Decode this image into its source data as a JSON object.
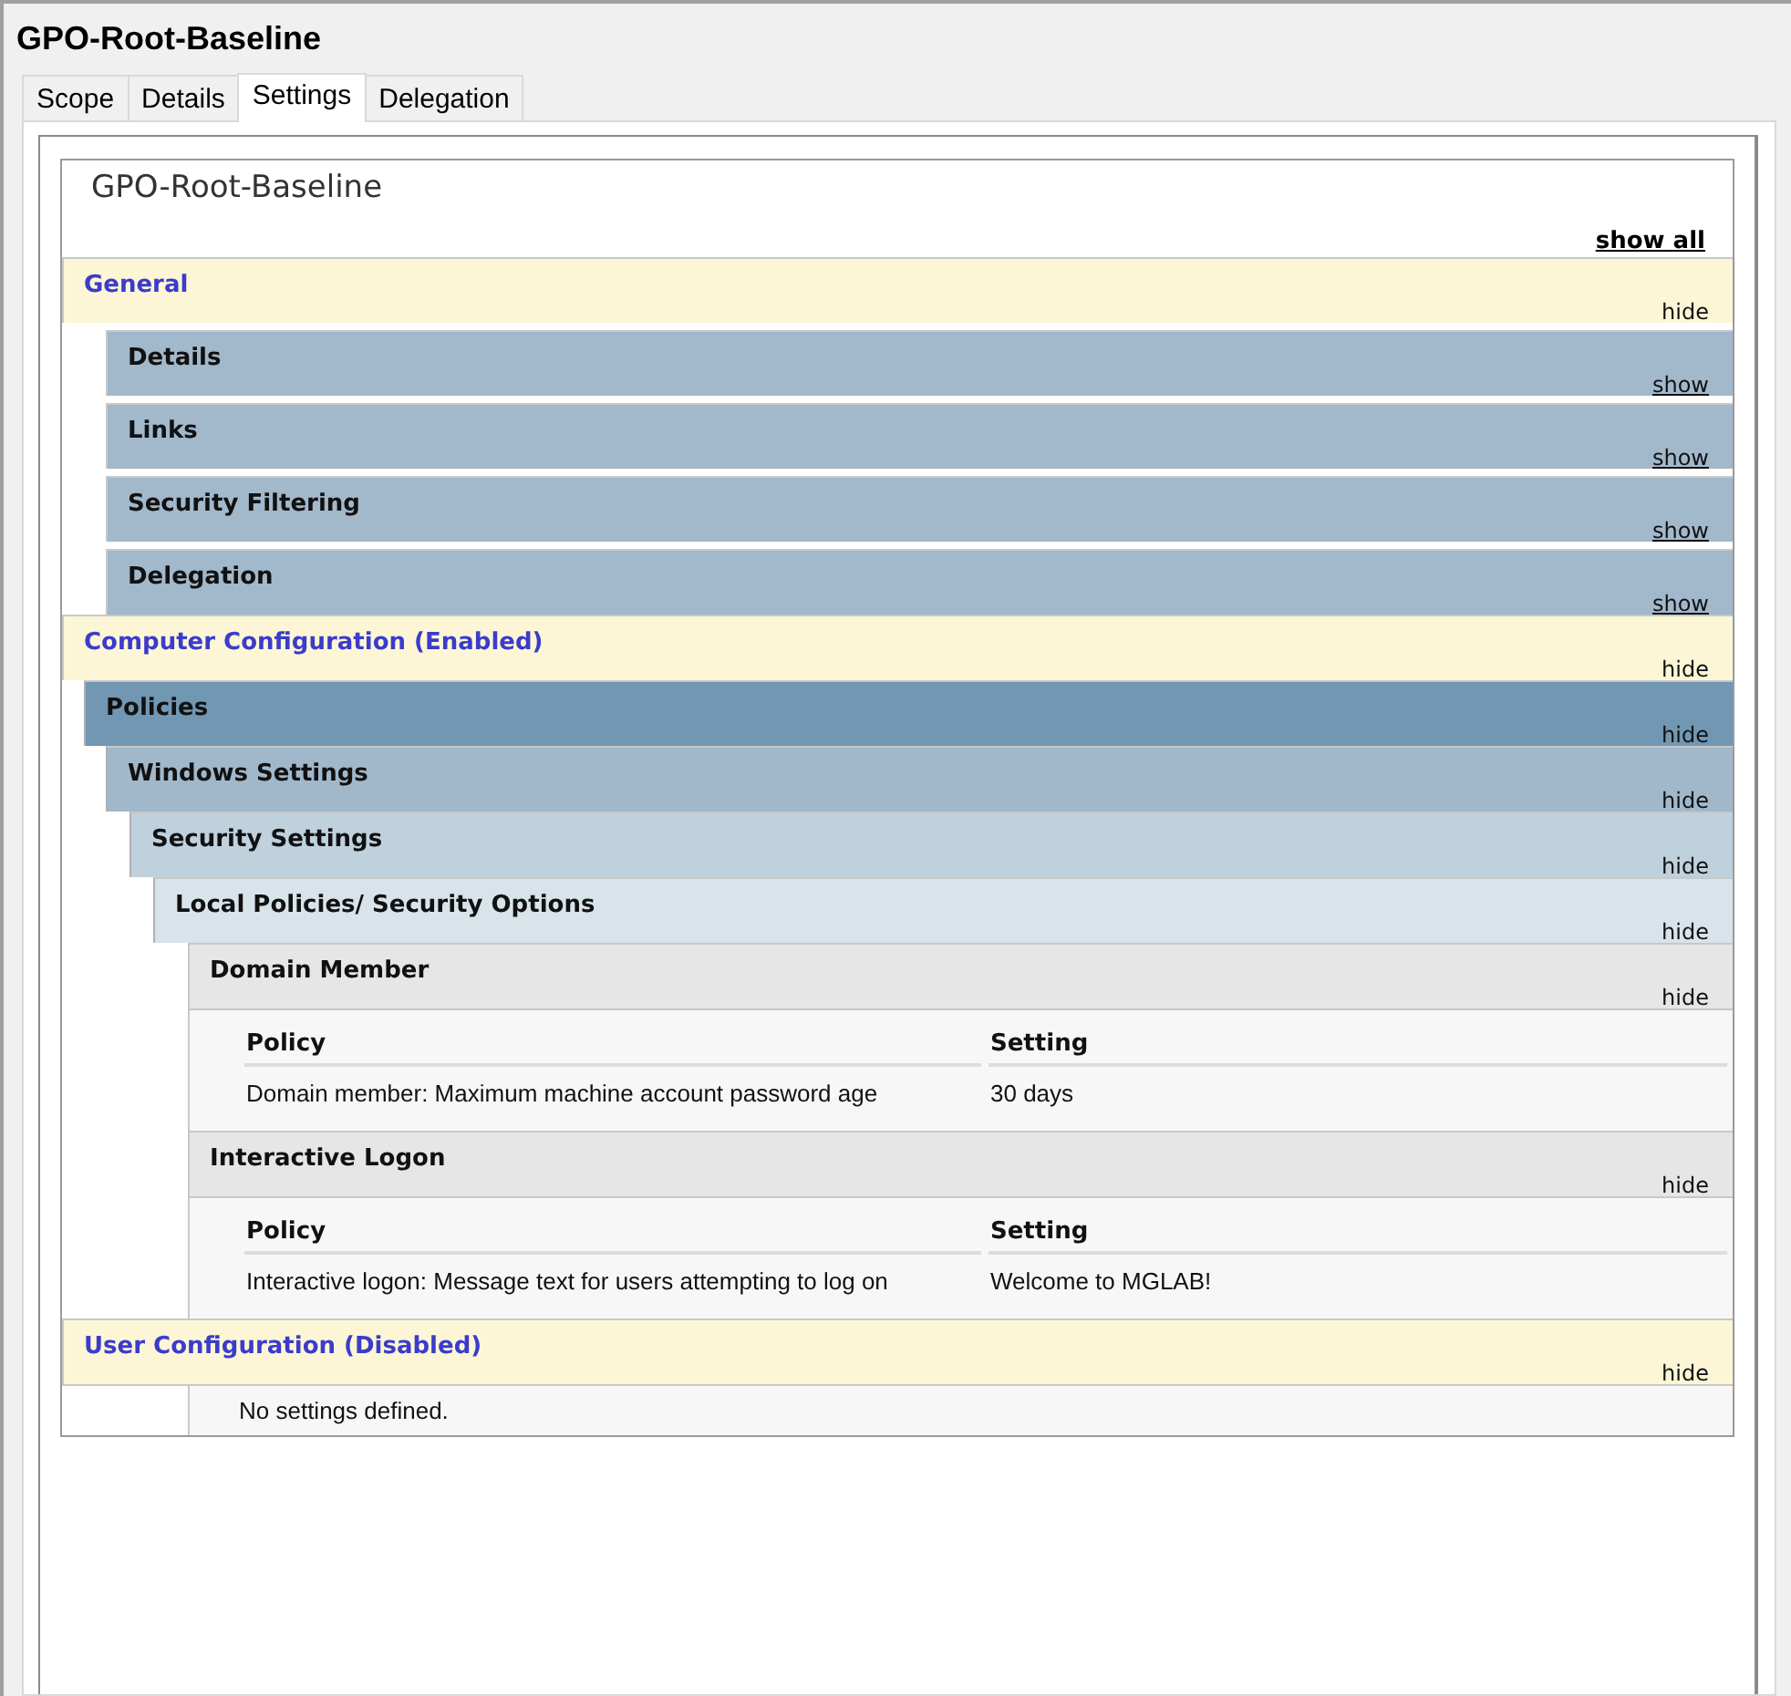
{
  "window": {
    "title": "GPO-Root-Baseline"
  },
  "tabs": [
    {
      "label": "Scope",
      "selected": false
    },
    {
      "label": "Details",
      "selected": false
    },
    {
      "label": "Settings",
      "selected": true
    },
    {
      "label": "Delegation",
      "selected": false
    }
  ],
  "report": {
    "title": "GPO-Root-Baseline",
    "show_all": "show all",
    "sections": [
      {
        "kind": "section",
        "title": "General",
        "toggle": "hide",
        "expanded": true,
        "children": [
          {
            "kind": "info",
            "title": "Details",
            "toggle": "show",
            "expanded": false
          },
          {
            "kind": "info",
            "title": "Links",
            "toggle": "show",
            "expanded": false
          },
          {
            "kind": "info",
            "title": "Security Filtering",
            "toggle": "show",
            "expanded": false
          },
          {
            "kind": "info",
            "title": "Delegation",
            "toggle": "show",
            "expanded": false
          }
        ]
      },
      {
        "kind": "section",
        "title": "Computer Configuration (Enabled)",
        "toggle": "hide",
        "expanded": true,
        "children": [
          {
            "kind": "category",
            "title": "Policies",
            "toggle": "hide",
            "expanded": true,
            "children": [
              {
                "kind": "category",
                "title": "Windows Settings",
                "toggle": "hide",
                "expanded": true,
                "children": [
                  {
                    "kind": "category",
                    "title": "Security Settings",
                    "toggle": "hide",
                    "expanded": true,
                    "children": [
                      {
                        "kind": "category",
                        "title": "Local Policies/ Security Options",
                        "toggle": "hide",
                        "expanded": true,
                        "children": [
                          {
                            "kind": "group",
                            "title": "Domain Member",
                            "toggle": "hide",
                            "expanded": true,
                            "columns": [
                              "Policy",
                              "Setting"
                            ],
                            "rows": [
                              [
                                "Domain member: Maximum machine account password age",
                                "30 days"
                              ]
                            ]
                          },
                          {
                            "kind": "group",
                            "title": "Interactive Logon",
                            "toggle": "hide",
                            "expanded": true,
                            "columns": [
                              "Policy",
                              "Setting"
                            ],
                            "rows": [
                              [
                                "Interactive logon: Message text for users attempting to log on",
                                "Welcome to MGLAB!"
                              ]
                            ]
                          }
                        ]
                      }
                    ]
                  }
                ]
              }
            ]
          }
        ]
      },
      {
        "kind": "section",
        "title": "User Configuration (Disabled)",
        "toggle": "hide",
        "expanded": true,
        "children": [
          {
            "kind": "note",
            "text": "No settings defined."
          }
        ]
      }
    ]
  }
}
